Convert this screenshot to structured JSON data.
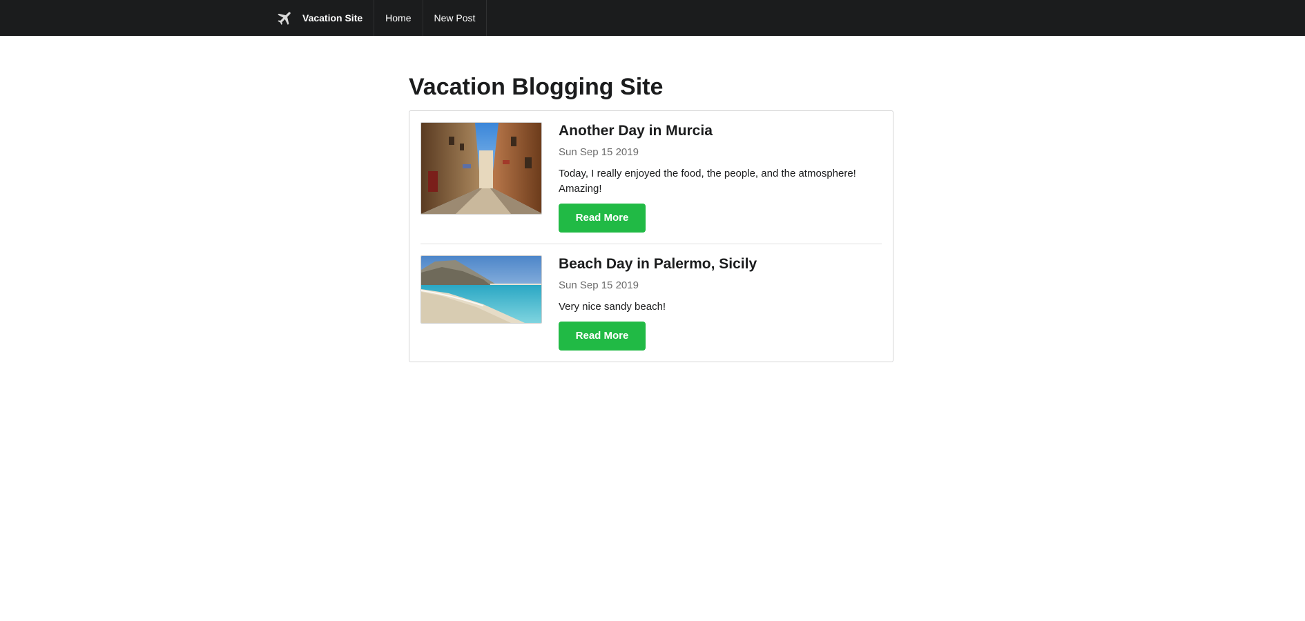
{
  "navbar": {
    "brand_icon": "airplane-icon",
    "brand_label": "Vacation Site",
    "items": [
      {
        "label": "Home"
      },
      {
        "label": "New Post"
      }
    ]
  },
  "main": {
    "title": "Vacation Blogging Site",
    "posts": [
      {
        "title": "Another Day in Murcia",
        "date": "Sun Sep 15 2019",
        "description": "Today, I really enjoyed the food, the people, and the atmosphere! Amazing!",
        "button_label": "Read More",
        "thumbnail": "narrow-street-photo"
      },
      {
        "title": "Beach Day in Palermo, Sicily",
        "date": "Sun Sep 15 2019",
        "description": "Very nice sandy beach!",
        "button_label": "Read More",
        "thumbnail": "beach-photo"
      }
    ]
  },
  "colors": {
    "navbar_bg": "#1b1c1d",
    "button_green": "#21ba45",
    "date_gray": "#6b6b6b"
  }
}
